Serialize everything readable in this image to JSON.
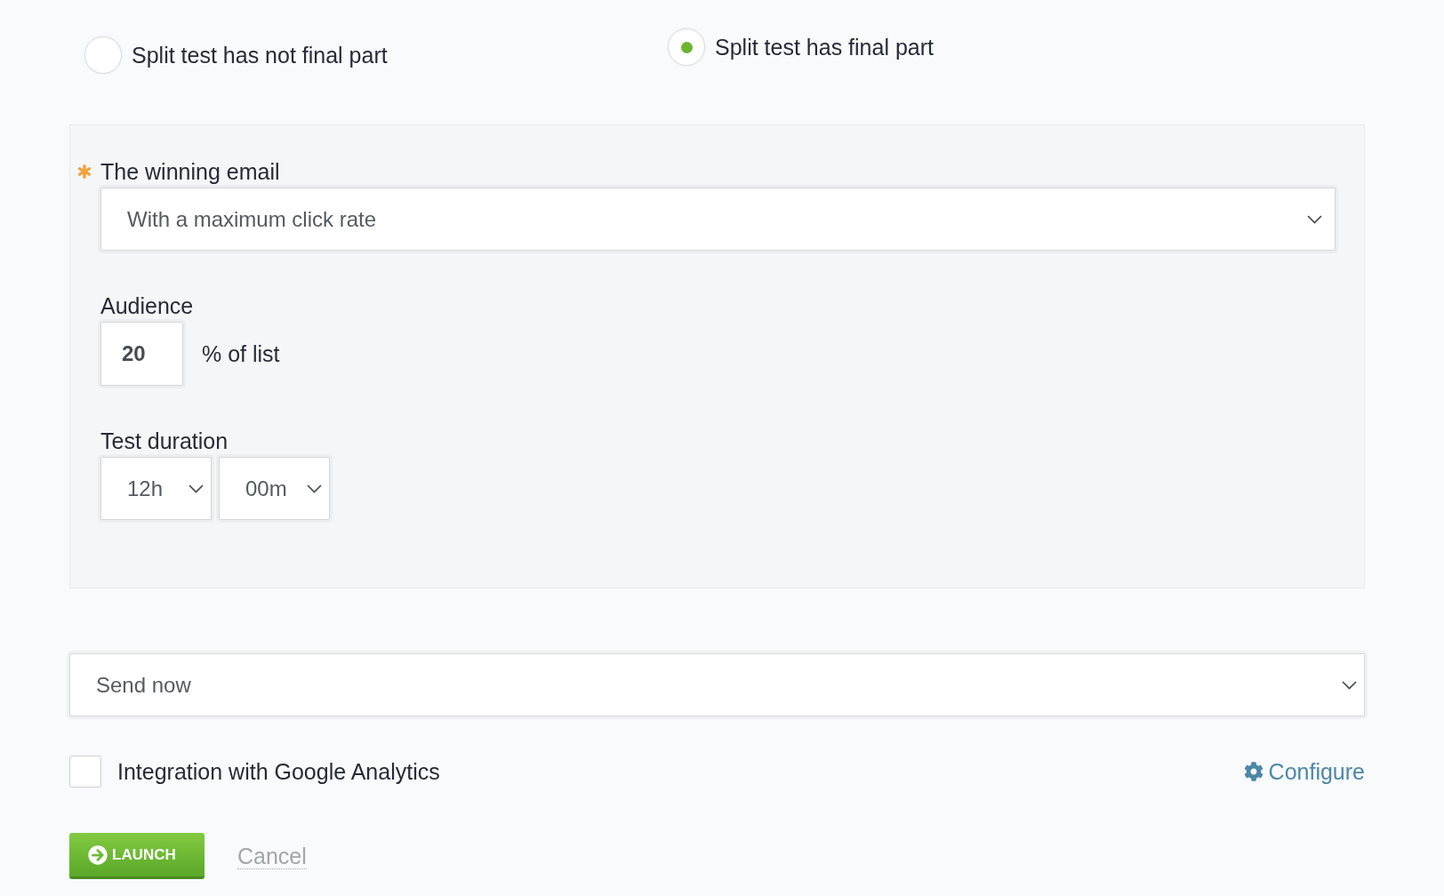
{
  "final_part_options": [
    {
      "label": "Split test has not final part",
      "selected": false
    },
    {
      "label": "Split test has final part",
      "selected": true
    }
  ],
  "settings_panel": {
    "winning_email": {
      "label": "The winning email",
      "required": true,
      "value": "With a maximum click rate"
    },
    "audience": {
      "label": "Audience",
      "value": "20",
      "suffix": "% of list"
    },
    "test_duration": {
      "label": "Test duration",
      "hours": "12h",
      "minutes": "00m"
    }
  },
  "send_time": {
    "value": "Send now"
  },
  "google_analytics": {
    "label": "Integration with Google Analytics",
    "checked": false,
    "configure_link": "Configure"
  },
  "actions": {
    "launch": "LAUNCH",
    "cancel": "Cancel"
  }
}
